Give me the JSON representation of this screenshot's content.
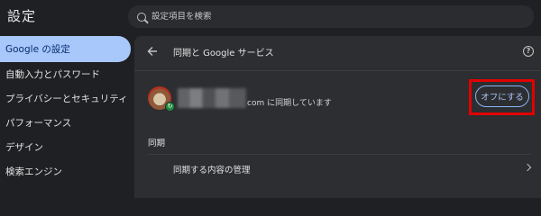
{
  "app": {
    "title": "設定"
  },
  "search": {
    "placeholder": "設定項目を検索"
  },
  "sidebar": {
    "items": [
      {
        "label": "Google の設定",
        "active": true
      },
      {
        "label": "自動入力とパスワード",
        "active": false
      },
      {
        "label": "プライバシーとセキュリティ",
        "active": false
      },
      {
        "label": "パフォーマンス",
        "active": false
      },
      {
        "label": "デザイン",
        "active": false
      },
      {
        "label": "検索エンジン",
        "active": false
      }
    ]
  },
  "main": {
    "title": "同期と Google サービス",
    "account": {
      "status_text": "com に同期しています",
      "turn_off_label": "オフにする"
    },
    "section_label": "同期",
    "sync_manage_label": "同期する内容の管理"
  },
  "icons": {
    "search": "search-icon",
    "back": "arrow-left-icon",
    "help": "help-icon",
    "chevron": "chevron-right-icon",
    "sync_badge": "sync-badge-icon"
  },
  "colors": {
    "background": "#1f2023",
    "panel": "#2d2e31",
    "accent": "#a8c7fa",
    "highlight": "#e10000",
    "sync_green": "#1e8e3e"
  }
}
